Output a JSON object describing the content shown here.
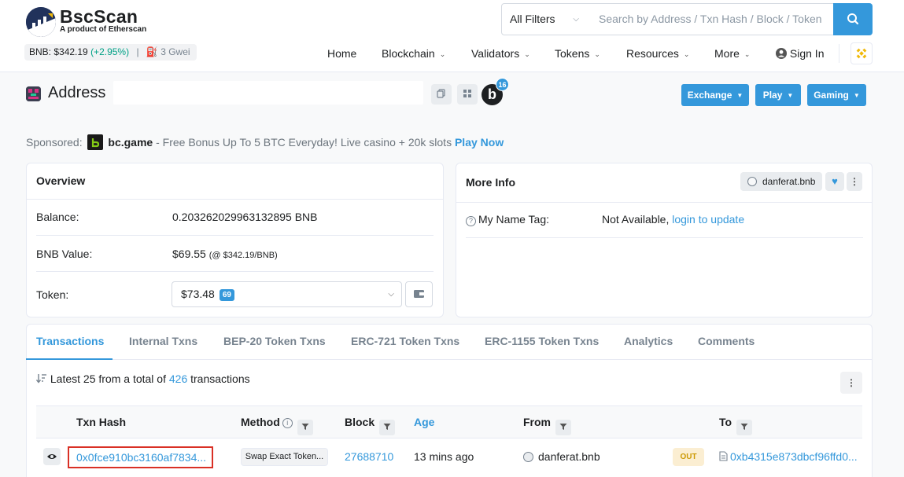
{
  "brand": {
    "name": "BscScan",
    "tagline": "A product of Etherscan"
  },
  "ticker": {
    "price_label": "BNB: $342.19",
    "change": "(+2.95%)",
    "separator": "|",
    "gas": "3 Gwei"
  },
  "search": {
    "filter": "All Filters",
    "placeholder": "Search by Address / Txn Hash / Block / Token"
  },
  "nav": {
    "home": "Home",
    "blockchain": "Blockchain",
    "validators": "Validators",
    "tokens": "Tokens",
    "resources": "Resources",
    "more": "More",
    "signin": "Sign In"
  },
  "address": {
    "title": "Address",
    "badge_letter": "b",
    "badge_count": "16",
    "buttons": {
      "exchange": "Exchange",
      "play": "Play",
      "gaming": "Gaming"
    }
  },
  "sponsored": {
    "label": "Sponsored:",
    "brand": "bc.game",
    "text": "- Free Bonus Up To 5 BTC Everyday! Live casino + 20k slots",
    "cta": "Play Now"
  },
  "overview": {
    "title": "Overview",
    "balance_label": "Balance:",
    "balance_value": "0.203262029963132895 BNB",
    "value_label": "BNB Value:",
    "value_amount": "$69.55",
    "value_rate": "(@ $342.19/BNB)",
    "token_label": "Token:",
    "token_value": "$73.48",
    "token_count": "69"
  },
  "more_info": {
    "title": "More Info",
    "name": "danferat.bnb",
    "name_tag_label": "My Name Tag:",
    "name_tag_value": "Not Available,",
    "name_tag_link": "login to update"
  },
  "tabs": [
    "Transactions",
    "Internal Txns",
    "BEP-20 Token Txns",
    "ERC-721 Token Txns",
    "ERC-1155 Token Txns",
    "Analytics",
    "Comments"
  ],
  "summary": {
    "prefix": "Latest 25 from a total of",
    "count": "426",
    "suffix": "transactions"
  },
  "columns": {
    "hash": "Txn Hash",
    "method": "Method",
    "block": "Block",
    "age": "Age",
    "from": "From",
    "to": "To"
  },
  "rows": [
    {
      "hash": "0x0fce910bc3160af7834...",
      "method": "Swap Exact Token...",
      "block": "27688710",
      "age": "13 mins ago",
      "from": "danferat.bnb",
      "direction": "OUT",
      "to": "0xb4315e873dbcf96ffd0..."
    }
  ],
  "colors": {
    "accent": "#3498db",
    "text": "#1e2022",
    "muted": "#77838f",
    "positive": "#00a186",
    "out_badge": "#cc9a06",
    "highlight_border": "#d93025"
  }
}
